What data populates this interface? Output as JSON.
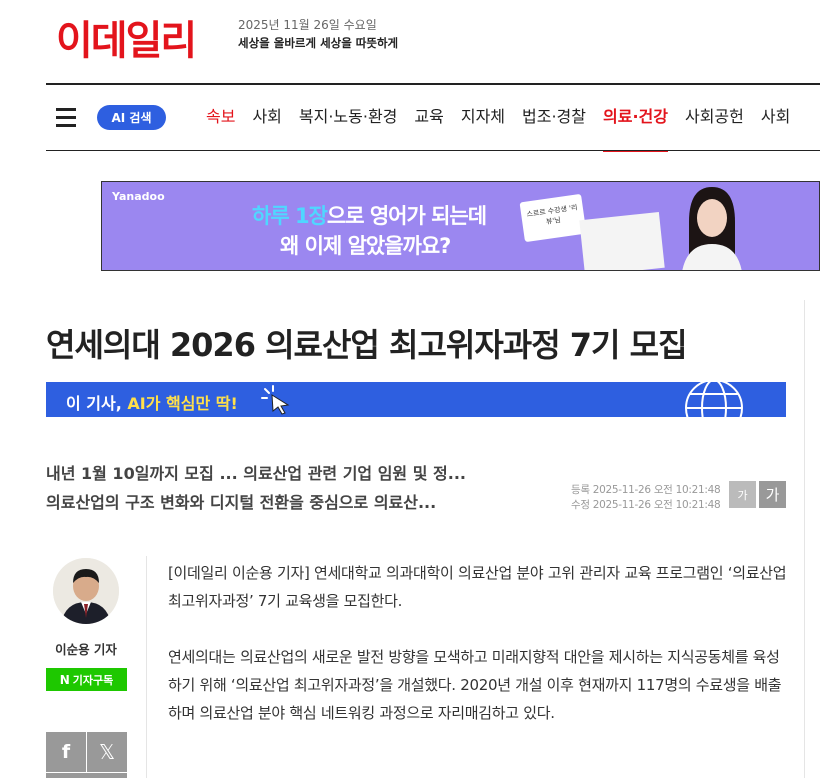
{
  "header": {
    "logo": "이데일리",
    "date": "2025년 11월 26일 수요일",
    "slogan": "세상을 올바르게 세상을 따뜻하게"
  },
  "nav": {
    "ai_search_label": "AI 검색",
    "items": [
      "속보",
      "사회",
      "복지·노동·환경",
      "교육",
      "지자체",
      "법조·경찰",
      "의료·건강",
      "사회공헌",
      "사회"
    ],
    "active_item": "의료·건강"
  },
  "ad": {
    "brand": "Yanadoo",
    "line1_highlight": "하루 1장",
    "line1_rest": "으로 영어가 되는데",
    "line2": "왜 이제 알았을까요?",
    "card_text": "스르르 수강생 '리뷰'님"
  },
  "article": {
    "headline": "연세의대 2026 의료산업 최고위자과정 7기 모집",
    "ai_bar": {
      "prefix": "이 기사, ",
      "highlight": "AI가 핵심만 딱!"
    },
    "summary": [
      "내년 1월 10일까지 모집 ... 의료산업 관련 기업 임원 및 정...",
      "의료산업의 구조 변화와 디지털 전환을 중심으로 의료산..."
    ],
    "registered": "등록 2025-11-26 오전 10:21:48",
    "modified": "수정 2025-11-26 오전 10:21:48",
    "font_small": "가",
    "font_large": "가",
    "reporter_name": "이순용 기자",
    "subscribe_label": "기자구독",
    "subscribe_icon": "N",
    "share_facebook": "f",
    "share_x": "𝕏",
    "paragraphs": [
      "[이데일리 이순용 기자] 연세대학교 의과대학이 의료산업 분야 고위 관리자 교육 프로그램인 ‘의료산업 최고위자과정’ 7기 교육생을 모집한다.",
      "연세의대는 의료산업의 새로운 발전 방향을 모색하고 미래지향적 대안을 제시하는 지식공동체를 육성하기 위해 ‘의료산업 최고위자과정’을 개설했다. 2020년 개설 이후 현재까지 117명의 수료생을 배출하며 의료산업 분야 핵심 네트워킹 과정으로 자리매김하고 있다."
    ]
  },
  "colors": {
    "brand_red": "#e3141c",
    "ai_blue": "#2e5fe0",
    "naver_green": "#1ec800",
    "ad_purple": "#9b87f0"
  }
}
